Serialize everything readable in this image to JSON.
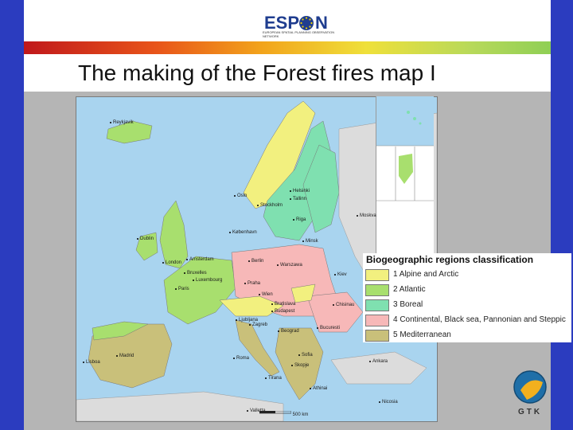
{
  "header": {
    "logo_text": "ESP N",
    "tagline": "EUROPEAN SPATIAL PLANNING OBSERVATION NETWORK"
  },
  "slide": {
    "title": "The making of the Forest fires map I"
  },
  "legend": {
    "title": "Biogeographic regions classification",
    "items": [
      {
        "label": "1 Alpine and Arctic",
        "color": "#f2f07f"
      },
      {
        "label": "2 Atlantic",
        "color": "#a8df6e"
      },
      {
        "label": "3 Boreal",
        "color": "#7fe0b0"
      },
      {
        "label": "4 Continental, Black sea, Pannonian and Steppic",
        "color": "#f7b8b8"
      },
      {
        "label": "5 Mediterranean",
        "color": "#c9c07a"
      }
    ]
  },
  "cities": [
    {
      "name": "Reykjavik"
    },
    {
      "name": "Oslo"
    },
    {
      "name": "Stockholm"
    },
    {
      "name": "Helsinki"
    },
    {
      "name": "Tallinn"
    },
    {
      "name": "Riga"
    },
    {
      "name": "Moskva"
    },
    {
      "name": "København"
    },
    {
      "name": "Dublin"
    },
    {
      "name": "London"
    },
    {
      "name": "Amsterdam"
    },
    {
      "name": "Bruxelles"
    },
    {
      "name": "Luxembourg"
    },
    {
      "name": "Paris"
    },
    {
      "name": "Berlin"
    },
    {
      "name": "Warszawa"
    },
    {
      "name": "Praha"
    },
    {
      "name": "Wien"
    },
    {
      "name": "Bratislava"
    },
    {
      "name": "Budapest"
    },
    {
      "name": "Ljubljana"
    },
    {
      "name": "Zagreb"
    },
    {
      "name": "Beograd"
    },
    {
      "name": "Bucuresti"
    },
    {
      "name": "Chisinau"
    },
    {
      "name": "Kiev"
    },
    {
      "name": "Minsk"
    },
    {
      "name": "Sofia"
    },
    {
      "name": "Skopje"
    },
    {
      "name": "Tirana"
    },
    {
      "name": "Roma"
    },
    {
      "name": "Madrid"
    },
    {
      "name": "Lisboa"
    },
    {
      "name": "Athinai"
    },
    {
      "name": "Ankara"
    },
    {
      "name": "Valletta"
    },
    {
      "name": "Nicosia"
    }
  ],
  "scale_label": "500 km",
  "brand": {
    "gtk": "GTK"
  }
}
